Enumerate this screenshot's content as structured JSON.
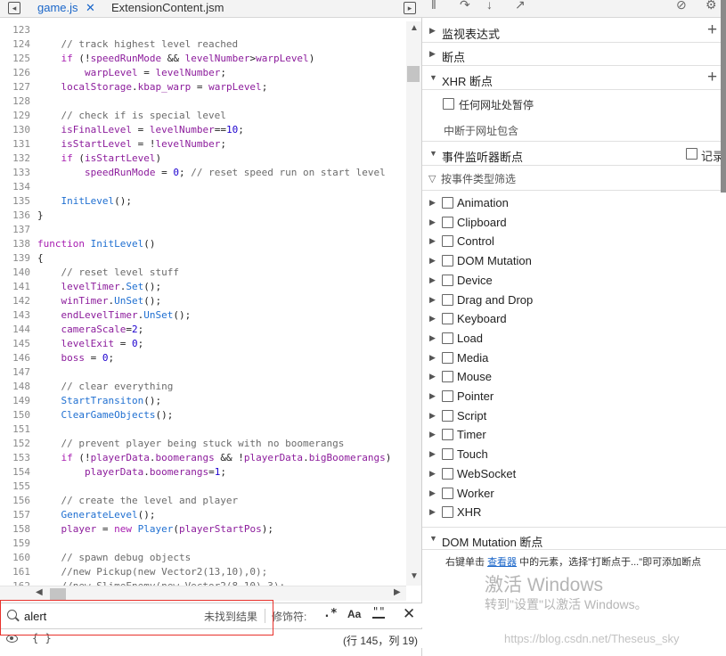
{
  "editor": {
    "tabs": [
      {
        "label": "game.js",
        "active": true,
        "close": "✕"
      },
      {
        "label": "ExtensionContent.jsm",
        "active": false
      }
    ],
    "lines": [
      {
        "n": "123",
        "t": []
      },
      {
        "n": "124",
        "t": [
          {
            "c": "cm",
            "s": "    // track highest level reached"
          }
        ]
      },
      {
        "n": "125",
        "t": [
          {
            "c": "kw",
            "s": "    if "
          },
          {
            "c": "pl",
            "s": "(!"
          },
          {
            "c": "var",
            "s": "speedRunMode"
          },
          {
            "c": "pl",
            "s": " && "
          },
          {
            "c": "var",
            "s": "levelNumber"
          },
          {
            "c": "pl",
            "s": ">"
          },
          {
            "c": "var",
            "s": "warpLevel"
          },
          {
            "c": "pl",
            "s": ")"
          }
        ]
      },
      {
        "n": "126",
        "t": [
          {
            "c": "var",
            "s": "        warpLevel"
          },
          {
            "c": "pl",
            "s": " = "
          },
          {
            "c": "var",
            "s": "levelNumber"
          },
          {
            "c": "pl",
            "s": ";"
          }
        ]
      },
      {
        "n": "127",
        "t": [
          {
            "c": "var",
            "s": "    localStorage"
          },
          {
            "c": "pl",
            "s": "."
          },
          {
            "c": "var",
            "s": "kbap_warp"
          },
          {
            "c": "pl",
            "s": " = "
          },
          {
            "c": "var",
            "s": "warpLevel"
          },
          {
            "c": "pl",
            "s": ";"
          }
        ]
      },
      {
        "n": "128",
        "t": []
      },
      {
        "n": "129",
        "t": [
          {
            "c": "cm",
            "s": "    // check if is special level"
          }
        ]
      },
      {
        "n": "130",
        "t": [
          {
            "c": "var",
            "s": "    isFinalLevel"
          },
          {
            "c": "pl",
            "s": " = "
          },
          {
            "c": "var",
            "s": "levelNumber"
          },
          {
            "c": "pl",
            "s": "=="
          },
          {
            "c": "num",
            "s": "10"
          },
          {
            "c": "pl",
            "s": ";"
          }
        ]
      },
      {
        "n": "131",
        "t": [
          {
            "c": "var",
            "s": "    isStartLevel"
          },
          {
            "c": "pl",
            "s": " = !"
          },
          {
            "c": "var",
            "s": "levelNumber"
          },
          {
            "c": "pl",
            "s": ";"
          }
        ]
      },
      {
        "n": "132",
        "t": [
          {
            "c": "kw",
            "s": "    if "
          },
          {
            "c": "pl",
            "s": "("
          },
          {
            "c": "var",
            "s": "isStartLevel"
          },
          {
            "c": "pl",
            "s": ")"
          }
        ]
      },
      {
        "n": "133",
        "t": [
          {
            "c": "var",
            "s": "        speedRunMode"
          },
          {
            "c": "pl",
            "s": " = "
          },
          {
            "c": "num",
            "s": "0"
          },
          {
            "c": "pl",
            "s": "; "
          },
          {
            "c": "cm",
            "s": "// reset speed run on start level"
          }
        ]
      },
      {
        "n": "134",
        "t": []
      },
      {
        "n": "135",
        "t": [
          {
            "c": "fn",
            "s": "    InitLevel"
          },
          {
            "c": "pl",
            "s": "();"
          }
        ]
      },
      {
        "n": "136",
        "t": [
          {
            "c": "pl",
            "s": "}"
          }
        ]
      },
      {
        "n": "137",
        "t": []
      },
      {
        "n": "138",
        "t": [
          {
            "c": "kw",
            "s": "function "
          },
          {
            "c": "fn",
            "s": "InitLevel"
          },
          {
            "c": "pl",
            "s": "()"
          }
        ]
      },
      {
        "n": "139",
        "t": [
          {
            "c": "pl",
            "s": "{"
          }
        ]
      },
      {
        "n": "140",
        "t": [
          {
            "c": "cm",
            "s": "    // reset level stuff"
          }
        ]
      },
      {
        "n": "141",
        "t": [
          {
            "c": "var",
            "s": "    levelTimer"
          },
          {
            "c": "pl",
            "s": "."
          },
          {
            "c": "fn",
            "s": "Set"
          },
          {
            "c": "pl",
            "s": "();"
          }
        ]
      },
      {
        "n": "142",
        "t": [
          {
            "c": "var",
            "s": "    winTimer"
          },
          {
            "c": "pl",
            "s": "."
          },
          {
            "c": "fn",
            "s": "UnSet"
          },
          {
            "c": "pl",
            "s": "();"
          }
        ]
      },
      {
        "n": "143",
        "t": [
          {
            "c": "var",
            "s": "    endLevelTimer"
          },
          {
            "c": "pl",
            "s": "."
          },
          {
            "c": "fn",
            "s": "UnSet"
          },
          {
            "c": "pl",
            "s": "();"
          }
        ]
      },
      {
        "n": "144",
        "t": [
          {
            "c": "var",
            "s": "    cameraScale"
          },
          {
            "c": "pl",
            "s": "="
          },
          {
            "c": "num",
            "s": "2"
          },
          {
            "c": "pl",
            "s": ";"
          }
        ]
      },
      {
        "n": "145",
        "t": [
          {
            "c": "var",
            "s": "    levelExit"
          },
          {
            "c": "pl",
            "s": " = "
          },
          {
            "c": "num",
            "s": "0"
          },
          {
            "c": "pl",
            "s": ";"
          }
        ]
      },
      {
        "n": "146",
        "t": [
          {
            "c": "var",
            "s": "    boss"
          },
          {
            "c": "pl",
            "s": " = "
          },
          {
            "c": "num",
            "s": "0"
          },
          {
            "c": "pl",
            "s": ";"
          }
        ]
      },
      {
        "n": "147",
        "t": []
      },
      {
        "n": "148",
        "t": [
          {
            "c": "cm",
            "s": "    // clear everything"
          }
        ]
      },
      {
        "n": "149",
        "t": [
          {
            "c": "fn",
            "s": "    StartTransiton"
          },
          {
            "c": "pl",
            "s": "();"
          }
        ]
      },
      {
        "n": "150",
        "t": [
          {
            "c": "fn",
            "s": "    ClearGameObjects"
          },
          {
            "c": "pl",
            "s": "();"
          }
        ]
      },
      {
        "n": "151",
        "t": []
      },
      {
        "n": "152",
        "t": [
          {
            "c": "cm",
            "s": "    // prevent player being stuck with no boomerangs"
          }
        ]
      },
      {
        "n": "153",
        "t": [
          {
            "c": "kw",
            "s": "    if "
          },
          {
            "c": "pl",
            "s": "(!"
          },
          {
            "c": "var",
            "s": "playerData"
          },
          {
            "c": "pl",
            "s": "."
          },
          {
            "c": "var",
            "s": "boomerangs"
          },
          {
            "c": "pl",
            "s": " && !"
          },
          {
            "c": "var",
            "s": "playerData"
          },
          {
            "c": "pl",
            "s": "."
          },
          {
            "c": "var",
            "s": "bigBoomerangs"
          },
          {
            "c": "pl",
            "s": ")"
          }
        ]
      },
      {
        "n": "154",
        "t": [
          {
            "c": "var",
            "s": "        playerData"
          },
          {
            "c": "pl",
            "s": "."
          },
          {
            "c": "var",
            "s": "boomerangs"
          },
          {
            "c": "pl",
            "s": "="
          },
          {
            "c": "num",
            "s": "1"
          },
          {
            "c": "pl",
            "s": ";"
          }
        ]
      },
      {
        "n": "155",
        "t": []
      },
      {
        "n": "156",
        "t": [
          {
            "c": "cm",
            "s": "    // create the level and player"
          }
        ]
      },
      {
        "n": "157",
        "t": [
          {
            "c": "fn",
            "s": "    GenerateLevel"
          },
          {
            "c": "pl",
            "s": "();"
          }
        ]
      },
      {
        "n": "158",
        "t": [
          {
            "c": "var",
            "s": "    player"
          },
          {
            "c": "pl",
            "s": " = "
          },
          {
            "c": "kw",
            "s": "new "
          },
          {
            "c": "fn",
            "s": "Player"
          },
          {
            "c": "pl",
            "s": "("
          },
          {
            "c": "var",
            "s": "playerStartPos"
          },
          {
            "c": "pl",
            "s": ");"
          }
        ]
      },
      {
        "n": "159",
        "t": []
      },
      {
        "n": "160",
        "t": [
          {
            "c": "cm",
            "s": "    // spawn debug objects"
          }
        ]
      },
      {
        "n": "161",
        "t": [
          {
            "c": "cm",
            "s": "    //new Pickup(new Vector2(13,10),0);"
          }
        ]
      },
      {
        "n": "162",
        "t": [
          {
            "c": "cm",
            "s": "    //new SlimeEnemy(new Vector2(8,10),3);"
          }
        ]
      },
      {
        "n": "163",
        "t": []
      }
    ],
    "search": {
      "value": "alert",
      "result": "未找到结果",
      "modifier_label": "修饰符:",
      "regex_toggle": ".*",
      "case_toggle": "Aa",
      "word_toggle": "\"\"",
      "close": "✕"
    },
    "status": {
      "braces": "{ }",
      "cursor_position": "(行 145，列 19)"
    }
  },
  "debugger": {
    "sections": {
      "watch": "监视表达式",
      "breakpoints": "断点",
      "xhr": "XHR 断点",
      "events": "事件监听器断点",
      "dom_mutation": "DOM Mutation 断点"
    },
    "xhr_pause_any": "任何网址处暂停",
    "xhr_break_when": "中断于网址包含",
    "log_label": "记录",
    "event_filter_placeholder": "按事件类型筛选",
    "event_categories": [
      "Animation",
      "Clipboard",
      "Control",
      "DOM Mutation",
      "Device",
      "Drag and Drop",
      "Keyboard",
      "Load",
      "Media",
      "Mouse",
      "Pointer",
      "Script",
      "Timer",
      "Touch",
      "WebSocket",
      "Worker",
      "XHR"
    ],
    "dom_msg_pre": "右键单击 ",
    "dom_msg_link": "查看器",
    "dom_msg_post": " 中的元素，选择\"打断点于...\"即可添加断点"
  },
  "overlay": {
    "win_activate_title": "激活 Windows",
    "win_activate_sub": "转到\"设置\"以激活 Windows。",
    "watermark": "https://blog.csdn.net/Theseus_sky"
  },
  "colors": {
    "active_tab": "#1a66c9",
    "highlight_box": "#e8312b",
    "keyword": "#a71db0",
    "function": "#1f6fd1",
    "comment": "#6b6b6b"
  }
}
